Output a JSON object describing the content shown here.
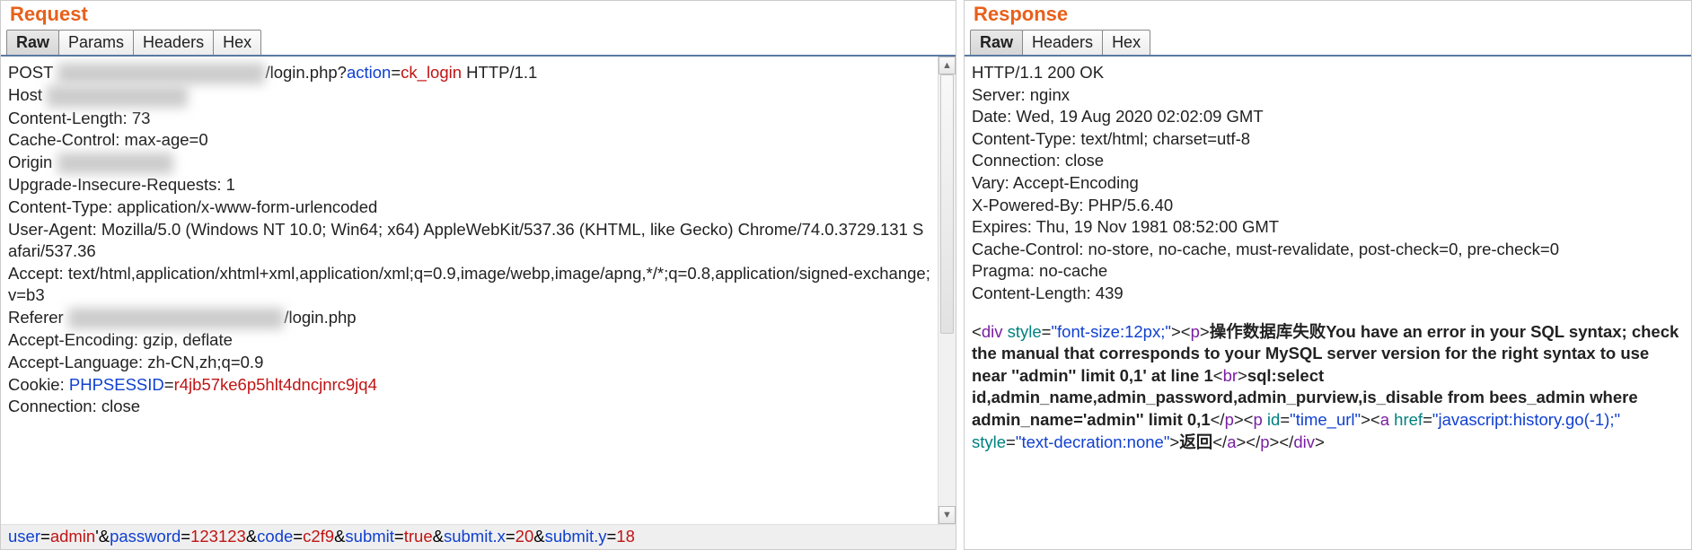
{
  "request": {
    "title": "Request",
    "tabs": {
      "raw": "Raw",
      "params": "Params",
      "headers": "Headers",
      "hex": "Hex"
    },
    "line1_pre": "POST",
    "line1_path": "/login.php?",
    "line1_qkey": "action",
    "line1_eq": "=",
    "line1_qval": "ck_login",
    "line1_post": " HTTP/1.1",
    "host_label": "Host",
    "h_content_length": "Content-Length: 73",
    "h_cache_control": "Cache-Control: max-age=0",
    "h_origin_label": "Origin",
    "h_upgrade": "Upgrade-Insecure-Requests: 1",
    "h_ctype": "Content-Type: application/x-www-form-urlencoded",
    "h_ua": "User-Agent: Mozilla/5.0 (Windows NT 10.0; Win64; x64) AppleWebKit/537.36 (KHTML, like Gecko) Chrome/74.0.3729.131 Safari/537.36",
    "h_accept": "Accept: text/html,application/xhtml+xml,application/xml;q=0.9,image/webp,image/apng,*/*;q=0.8,application/signed-exchange;v=b3",
    "h_referer_label": "Referer",
    "h_referer_tail": "/login.php",
    "h_accenc": "Accept-Encoding: gzip, deflate",
    "h_acclang": "Accept-Language: zh-CN,zh;q=0.9",
    "h_cookie_label": "Cookie: ",
    "h_cookie_key": "PHPSESSID",
    "h_cookie_eq": "=",
    "h_cookie_val": "r4jb57ke6p5hlt4dncjnrc9jq4",
    "h_conn": "Connection: close",
    "post": {
      "k_user": "user",
      "v_user": "admin",
      "tick": "'",
      "amp": "&",
      "eq": "=",
      "k_password": "password",
      "v_password": "123123",
      "k_code": "code",
      "v_code": "c2f9",
      "k_submit": "submit",
      "v_submit": "true",
      "k_submitx": "submit.x",
      "v_submitx": "20",
      "k_submity": "submit.y",
      "v_submity": "18"
    }
  },
  "response": {
    "title": "Response",
    "tabs": {
      "raw": "Raw",
      "headers": "Headers",
      "hex": "Hex"
    },
    "status": "HTTP/1.1 200 OK",
    "h_server": "Server: nginx",
    "h_date": "Date: Wed, 19 Aug 2020 02:02:09 GMT",
    "h_ctype": "Content-Type: text/html; charset=utf-8",
    "h_conn": "Connection: close",
    "h_vary": "Vary: Accept-Encoding",
    "h_xpb": "X-Powered-By: PHP/5.6.40",
    "h_expires": "Expires: Thu, 19 Nov 1981 08:52:00 GMT",
    "h_cache": "Cache-Control: no-store, no-cache, must-revalidate, post-check=0, pre-check=0",
    "h_pragma": "Pragma: no-cache",
    "h_clen": "Content-Length: 439",
    "html": {
      "lt": "<",
      "gt": ">",
      "sl": "/",
      "div": "div",
      "p": "p",
      "br": "br",
      "a": "a",
      "sp": " ",
      "attr_style": "style",
      "attr_id": "id",
      "attr_href": "href",
      "eq": "=",
      "q": "\"",
      "val_style1": "font-size:12px;",
      "msg1": "操作数据库失败You have an error in your SQL syntax; check the manual that corresponds to your MySQL server version for the right syntax to use near ''admin'' limit 0,1' at line 1",
      "msg2": "sql:select id,admin_name,admin_password,admin_purview,is_disable from bees_admin where admin_name='admin'' limit 0,1",
      "val_id": "time_url",
      "val_href": "javascript:history.go(-1);",
      "val_style2": "text-decration:none",
      "link_text": "返回"
    }
  }
}
